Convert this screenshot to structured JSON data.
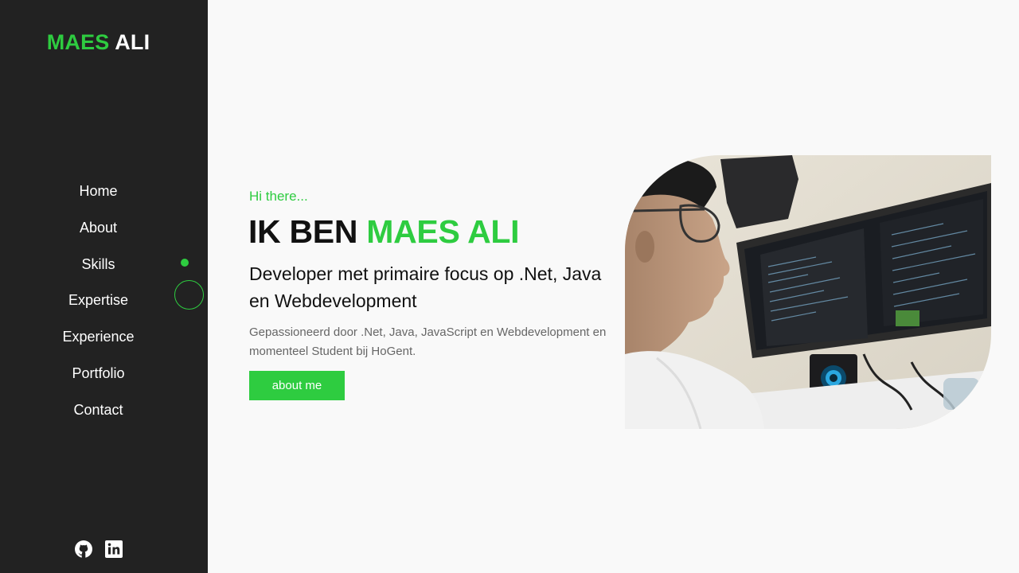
{
  "sidebar": {
    "logo_first": "MAES",
    "logo_second": "ALI",
    "nav": [
      "Home",
      "About",
      "Skills",
      "Expertise",
      "Experience",
      "Portfolio",
      "Contact"
    ],
    "social_icons": [
      "github-icon",
      "linkedin-icon"
    ]
  },
  "hero": {
    "greeting": "Hi there...",
    "title_prefix": "IK BEN",
    "title_name": "MAES ALI",
    "subtitle": "Developer met primaire focus op .Net, Java en Webdevelopment",
    "description": "Gepassioneerd door .Net, Java, JavaScript en Webdevelopment en momenteel Student bij HoGent.",
    "button_label": "about me"
  },
  "colors": {
    "accent": "#2ecc40",
    "sidebar_bg": "#222222",
    "page_bg": "#f9f9f9"
  }
}
